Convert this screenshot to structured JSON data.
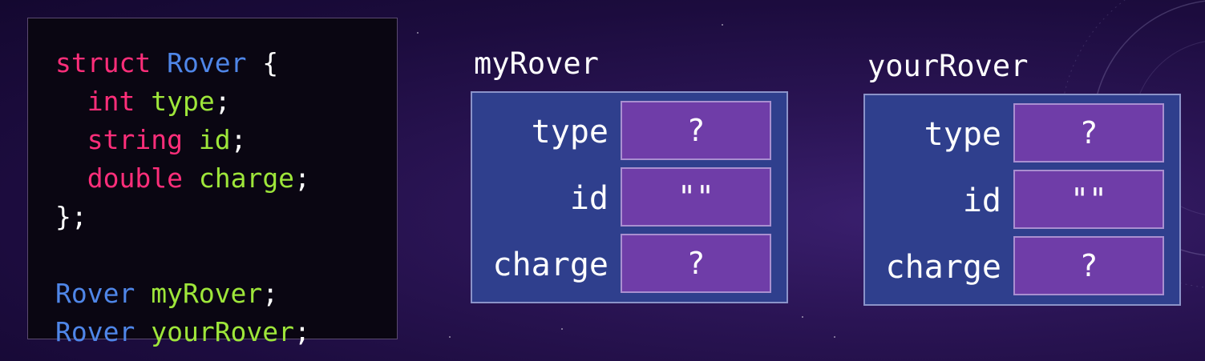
{
  "code": {
    "lines": [
      [
        {
          "t": "struct",
          "c": "kw"
        },
        {
          "t": " ",
          "c": "pn"
        },
        {
          "t": "Rover",
          "c": "ty"
        },
        {
          "t": " {",
          "c": "pn"
        }
      ],
      [
        {
          "t": "  ",
          "c": "pn"
        },
        {
          "t": "int",
          "c": "kw"
        },
        {
          "t": " ",
          "c": "pn"
        },
        {
          "t": "type",
          "c": "id"
        },
        {
          "t": ";",
          "c": "pn"
        }
      ],
      [
        {
          "t": "  ",
          "c": "pn"
        },
        {
          "t": "string",
          "c": "kw"
        },
        {
          "t": " ",
          "c": "pn"
        },
        {
          "t": "id",
          "c": "id"
        },
        {
          "t": ";",
          "c": "pn"
        }
      ],
      [
        {
          "t": "  ",
          "c": "pn"
        },
        {
          "t": "double",
          "c": "kw"
        },
        {
          "t": " ",
          "c": "pn"
        },
        {
          "t": "charge",
          "c": "id"
        },
        {
          "t": ";",
          "c": "pn"
        }
      ],
      [
        {
          "t": "};",
          "c": "pn"
        }
      ],
      [],
      [
        {
          "t": "Rover",
          "c": "ty"
        },
        {
          "t": " ",
          "c": "pn"
        },
        {
          "t": "myRover",
          "c": "id"
        },
        {
          "t": ";",
          "c": "pn"
        }
      ],
      [
        {
          "t": "Rover",
          "c": "ty"
        },
        {
          "t": " ",
          "c": "pn"
        },
        {
          "t": "yourRover",
          "c": "id"
        },
        {
          "t": ";",
          "c": "pn"
        }
      ]
    ]
  },
  "structs": [
    {
      "name": "myRover",
      "fields": [
        {
          "label": "type",
          "value": "?"
        },
        {
          "label": "id",
          "value": "\"\""
        },
        {
          "label": "charge",
          "value": "?"
        }
      ]
    },
    {
      "name": "yourRover",
      "fields": [
        {
          "label": "type",
          "value": "?"
        },
        {
          "label": "id",
          "value": "\"\""
        },
        {
          "label": "charge",
          "value": "?"
        }
      ]
    }
  ],
  "colors": {
    "keyword": "#ff2e7a",
    "type": "#4f86e8",
    "identifier": "#9ee63a",
    "struct_box": "#2f3f8d",
    "field_cell": "#6f3da8"
  }
}
